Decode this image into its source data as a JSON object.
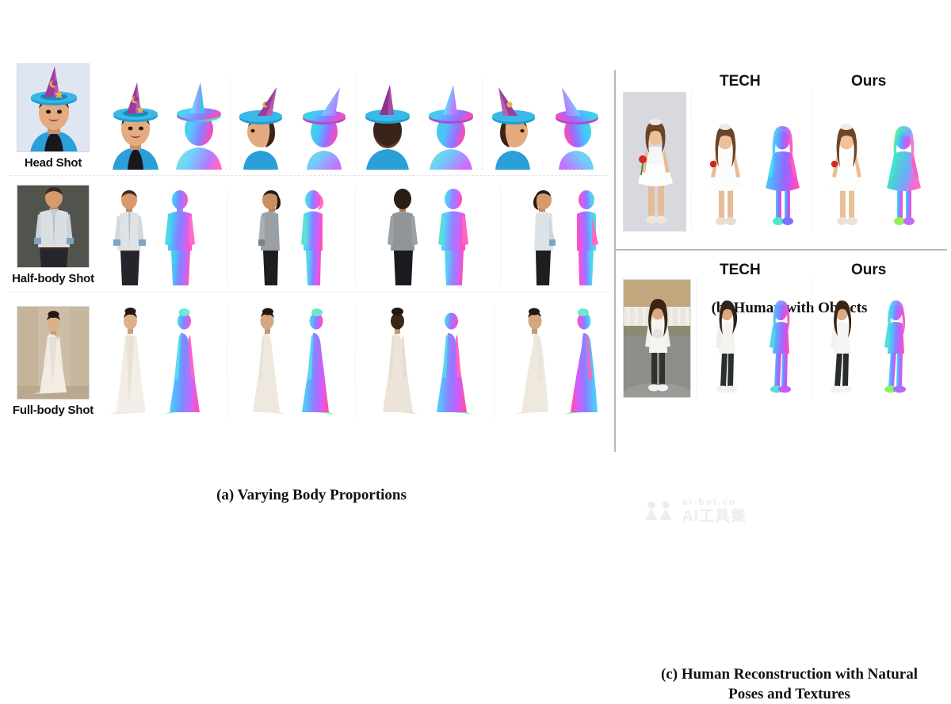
{
  "figure": {
    "background": "#ffffff",
    "divider_color": "#b9b9b9"
  },
  "panel_a": {
    "caption": "(a) Varying Body Proportions",
    "rows": [
      {
        "id": "head-shot",
        "input_label": "Head Shot",
        "input_bg": "#dfe6f2",
        "subject": "boy-wizard-hat",
        "views": [
          {
            "name": "front",
            "texture": "textured-render",
            "normal": "normal-map-render"
          },
          {
            "name": "side-left",
            "texture": "textured-render",
            "normal": "normal-map-render"
          },
          {
            "name": "back",
            "texture": "textured-render",
            "normal": "normal-map-render"
          },
          {
            "name": "side-right",
            "texture": "textured-render",
            "normal": "normal-map-render"
          }
        ]
      },
      {
        "id": "half-body-shot",
        "input_label": "Half-body Shot",
        "input_bg": "#4d4f4a",
        "subject": "man-grey-shirt",
        "views": [
          {
            "name": "front",
            "texture": "textured-render",
            "normal": "normal-map-render"
          },
          {
            "name": "side-left",
            "texture": "textured-render",
            "normal": "normal-map-render"
          },
          {
            "name": "back",
            "texture": "textured-render",
            "normal": "normal-map-render"
          },
          {
            "name": "side-right",
            "texture": "textured-render",
            "normal": "normal-map-render"
          }
        ]
      },
      {
        "id": "full-body-shot",
        "input_label": "Full-body Shot",
        "input_bg": "#cdbda6",
        "subject": "woman-white-gown",
        "views": [
          {
            "name": "front",
            "texture": "textured-render",
            "normal": "normal-map-render"
          },
          {
            "name": "side-left",
            "texture": "textured-render",
            "normal": "normal-map-render"
          },
          {
            "name": "back",
            "texture": "textured-render",
            "normal": "normal-map-render"
          },
          {
            "name": "side-right",
            "texture": "textured-render",
            "normal": "normal-map-render"
          }
        ]
      }
    ]
  },
  "panel_b": {
    "caption": "(b) Human with Objects",
    "method_labels": {
      "baseline": "TECH",
      "ours": "Ours"
    },
    "input_bg": "#d7d9de",
    "subject": "girl-white-dress-with-rose",
    "columns": [
      "input-photo",
      "TECH",
      "Ours"
    ]
  },
  "panel_c": {
    "caption_line1": "(c) Human Reconstruction with Natural",
    "caption_line2": "Poses and Textures",
    "method_labels": {
      "baseline": "TECH",
      "ours": "Ours"
    },
    "input_bg": "#9a9389",
    "subject": "woman-white-sweater-street",
    "columns": [
      "input-photo",
      "TECH",
      "Ours"
    ]
  },
  "watermark": {
    "url": "ai-bot.cn",
    "name": "AI工具集",
    "color": "#dcdcdc"
  }
}
